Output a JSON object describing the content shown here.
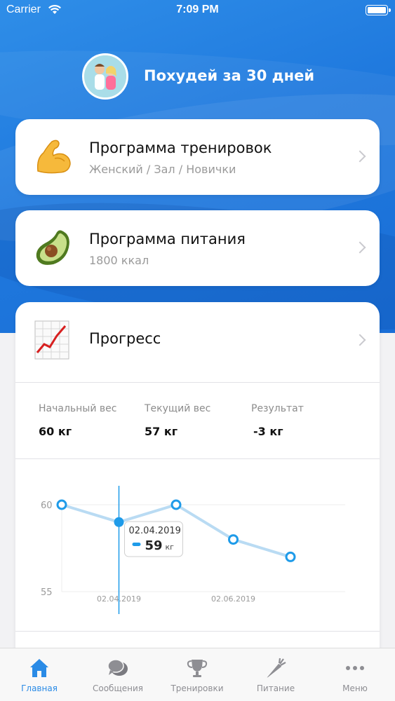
{
  "status_bar": {
    "carrier": "Carrier",
    "time": "7:09 PM"
  },
  "header": {
    "title": "Похудей за 30 дней"
  },
  "cards": [
    {
      "title": "Программа тренировок",
      "subtitle": "Женский / Зал / Новички",
      "icon": "flexed-biceps-emoji"
    },
    {
      "title": "Программа питания",
      "subtitle": "1800 ккал",
      "icon": "avocado-emoji"
    }
  ],
  "progress": {
    "title": "Прогресс",
    "icon": "chart-increasing-emoji",
    "stats": [
      {
        "label": "Начальный вес",
        "value": "60 кг"
      },
      {
        "label": "Текущий вес",
        "value": "57 кг"
      },
      {
        "label": "Результат",
        "value": "-3 кг"
      }
    ]
  },
  "chart_data": {
    "type": "line",
    "x_tick_labels": [
      "02.04.2019",
      "02.06.2019"
    ],
    "y_tick_labels": [
      "60",
      "55"
    ],
    "ylim": [
      55,
      60
    ],
    "series": [
      {
        "values": [
          60,
          59,
          60,
          58,
          57
        ]
      }
    ],
    "selected_index": 1,
    "tooltip": {
      "date": "02.04.2019",
      "value": "59",
      "unit": "кг"
    },
    "line_color": "#b9dbf3",
    "point_color": "#1e9be9"
  },
  "tabbar": {
    "items": [
      {
        "label": "Главная",
        "icon": "home-icon",
        "active": true
      },
      {
        "label": "Сообщения",
        "icon": "chat-bubbles-icon",
        "active": false
      },
      {
        "label": "Тренировки",
        "icon": "trophy-icon",
        "active": false
      },
      {
        "label": "Питание",
        "icon": "carrot-icon",
        "active": false
      },
      {
        "label": "Меню",
        "icon": "more-dots-icon",
        "active": false
      }
    ]
  },
  "colors": {
    "accent": "#2a8be6",
    "hero": "#1f79de"
  }
}
